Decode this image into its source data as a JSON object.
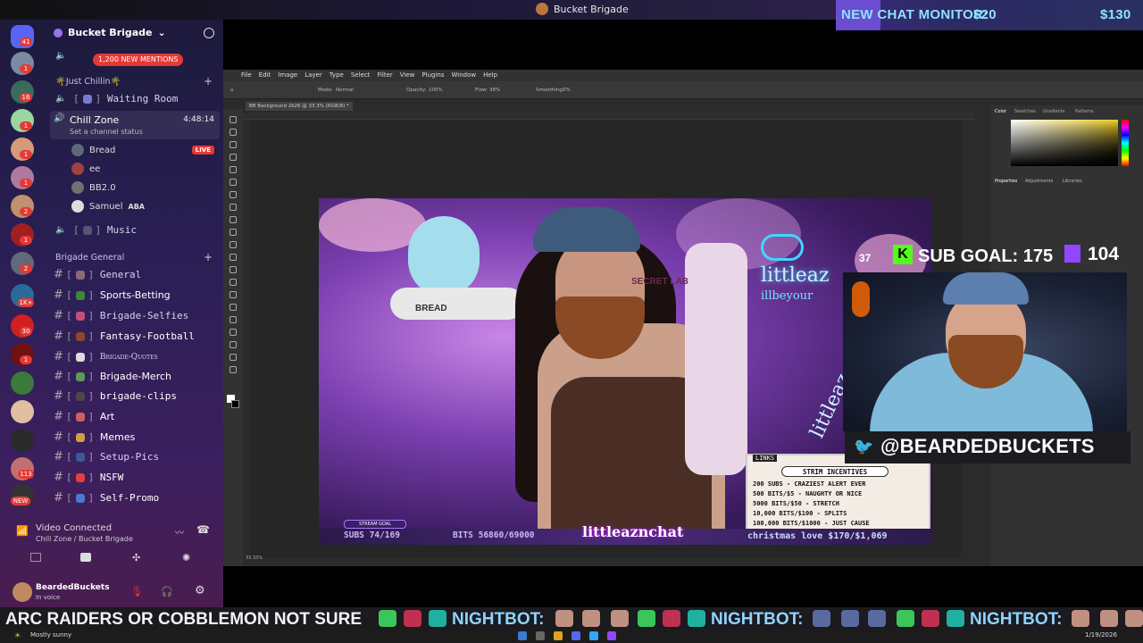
{
  "topbar": {
    "window_title": "Bucket Brigade"
  },
  "monitor": {
    "label": "NEW CHAT MONITOR:",
    "amount1": "$20",
    "amount2": "$130"
  },
  "discord": {
    "server_name": "Bucket Brigade",
    "mentions_pill": "1,200 NEW MENTIONS",
    "guild_badges": [
      "41",
      "1",
      "16",
      "1",
      "1",
      "1",
      "2",
      "1",
      "2",
      "1K+",
      "30",
      "1",
      "113",
      "NEW"
    ],
    "category_just_chillin": "🌴Just Chillin🌴",
    "waiting_room": "Waiting Room",
    "chill_zone": {
      "name": "Chill Zone",
      "time": "4:48:14",
      "status": "Set a channel status"
    },
    "voice_users": [
      {
        "name": "Bread",
        "live": "LIVE"
      },
      {
        "name": "ee",
        "live": ""
      },
      {
        "name": "BB2.0",
        "live": ""
      },
      {
        "name": "Samuel",
        "tag": "ABA"
      }
    ],
    "music": "Music",
    "category_brigade_general": "Brigade General",
    "channels": [
      "General",
      "Sports-Betting",
      "Brigade-Selfies",
      "Fantasy-Football",
      "Brigade-Quotes",
      "Brigade-Merch",
      "brigade-clips",
      "Art",
      "Memes",
      "Setup-Pics",
      "NSFW",
      "Self-Promo"
    ],
    "voice_connected": {
      "title": "Video Connected",
      "subtitle": "Chill Zone / Bucket Brigade"
    },
    "user": {
      "name": "BeardedBuckets",
      "status": "In voice"
    }
  },
  "photoshop": {
    "menus": [
      "File",
      "Edit",
      "Image",
      "Layer",
      "Type",
      "Select",
      "Filter",
      "View",
      "Plugins",
      "Window",
      "Help"
    ],
    "doc_tab": "BB Background 2k26 @ 33.3% (RGB/8) *",
    "zoom_status": "33.33%",
    "panel_tabs": [
      "Color",
      "Swatches",
      "Gradients",
      "Patterns"
    ],
    "props_tabs": [
      "Properties",
      "Adjustments",
      "Libraries"
    ],
    "options": {
      "mode": "Mode:",
      "mode_value": "Normal",
      "opacity": "Opacity:",
      "opacity_value": "100%",
      "flow": "Flow:",
      "flow_value": "38%",
      "smoothing": "Smoothing:",
      "smoothing_value": "0%"
    }
  },
  "stream": {
    "mic_label": "BREAD",
    "neon": "littleaz",
    "neon2": "illbeyour",
    "neon3": "littleaz",
    "chair_label": "SECRET LAB",
    "links_header": "LINKS",
    "incentives_title": "STRIM INCENTIVES",
    "incentives": [
      "200 SUBS - CRAZIEST ALERT EVER",
      "500 BITS/$5 - NAUGHTY OR NICE",
      "5000 BITS/$50 - STRETCH",
      "10,000 BITS/$100 - SPLITS",
      "100,000 BITS/$1000 - JUST CAUSE"
    ],
    "subs": "SUBS 74/169",
    "bits": "BITS 56860/69000",
    "channel": "littleaznchat",
    "christmas": "christmas love $170/$1,069",
    "badge": "STREAM GOAL"
  },
  "subgoal": {
    "count_left": "37",
    "label": "SUB GOAL: 175",
    "twitch_count": "104"
  },
  "cam": {
    "handle": "@BEARDEDBUCKETS"
  },
  "ticker": {
    "segments": [
      "ARC RAIDERS OR COBBLEMON NOT SURE",
      "NIGHTBOT:",
      "NIGHTBOT:",
      "NIGHTBOT:"
    ]
  },
  "taskbar": {
    "weather": "Mostly sunny",
    "date": "1/19/2026"
  },
  "colors": {
    "discord_bg": "#2a1f55",
    "mention_red": "#e53935",
    "ticker_yellow": "#f2f2f2",
    "ticker_blue": "#8fd3ff",
    "twitch_purple": "#9146ff",
    "kick_green": "#53fc18"
  }
}
